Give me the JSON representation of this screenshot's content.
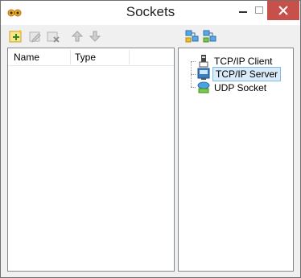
{
  "window": {
    "title": "Sockets"
  },
  "titlebar": {
    "app_icon": "owl-glasses-icon",
    "buttons": [
      "minimize-icon",
      "maximize-icon",
      "close-icon"
    ]
  },
  "toolbar_left": {
    "icons": [
      "new-socket-icon",
      "edit-socket-icon",
      "delete-socket-icon",
      "move-up-icon",
      "move-down-icon"
    ]
  },
  "toolbar_right": {
    "icons": [
      "add-network-icon",
      "remove-network-icon"
    ]
  },
  "list": {
    "columns": [
      "Name",
      "Type"
    ]
  },
  "tree": {
    "items": [
      {
        "label": "TCP/IP Client",
        "icon": "tcp-client-icon"
      },
      {
        "label": "TCP/IP Server",
        "icon": "tcp-server-icon",
        "selected": true
      },
      {
        "label": "UDP Socket",
        "icon": "udp-socket-icon"
      }
    ]
  },
  "colors": {
    "close_button": "#c7504a",
    "selection": "#d9ebf9"
  }
}
